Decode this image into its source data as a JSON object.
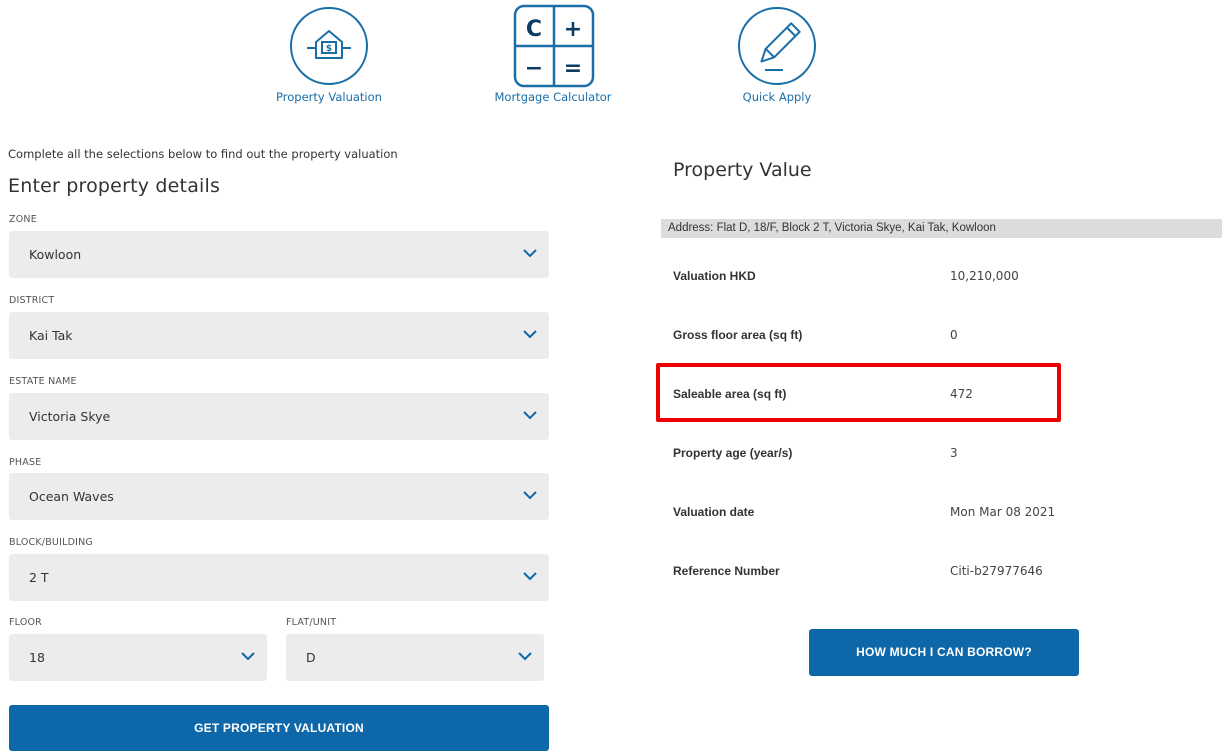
{
  "nav": {
    "items": [
      {
        "label": "Property Valuation",
        "icon": "house-dollar-icon"
      },
      {
        "label": "Mortgage Calculator",
        "icon": "calculator-icon"
      },
      {
        "label": "Quick Apply",
        "icon": "pencil-icon"
      }
    ],
    "calculator_keys": [
      "C",
      "+",
      "−",
      "="
    ]
  },
  "form": {
    "intro": "Complete all the selections below to find out the property valuation",
    "title": "Enter property details",
    "zone": {
      "label": "ZONE",
      "value": "Kowloon"
    },
    "district": {
      "label": "DISTRICT",
      "value": "Kai Tak"
    },
    "estate": {
      "label": "ESTATE NAME",
      "value": "Victoria Skye"
    },
    "phase": {
      "label": "PHASE",
      "value": "Ocean Waves"
    },
    "block": {
      "label": "BLOCK/BUILDING",
      "value": "2 T"
    },
    "floor": {
      "label": "FLOOR",
      "value": "18"
    },
    "flat": {
      "label": "FLAT/UNIT",
      "value": "D"
    },
    "submit_label": "GET PROPERTY VALUATION"
  },
  "result": {
    "title": "Property Value",
    "address": "Address: Flat D, 18/F, Block 2 T, Victoria Skye, Kai Tak, Kowloon",
    "rows": [
      {
        "label": "Valuation HKD",
        "value": "10,210,000"
      },
      {
        "label": "Gross floor area (sq ft)",
        "value": "0"
      },
      {
        "label": "Saleable area (sq ft)",
        "value": "472"
      },
      {
        "label": "Property age (year/s)",
        "value": "3"
      },
      {
        "label": "Valuation date",
        "value": "Mon Mar 08 2021"
      },
      {
        "label": "Reference Number",
        "value": "Citi-b27977646"
      }
    ],
    "borrow_label": "HOW MUCH I CAN BORROW?"
  },
  "colors": {
    "primary": "#0d67a8",
    "highlight": "#ef0000",
    "field_bg": "#ececec"
  }
}
